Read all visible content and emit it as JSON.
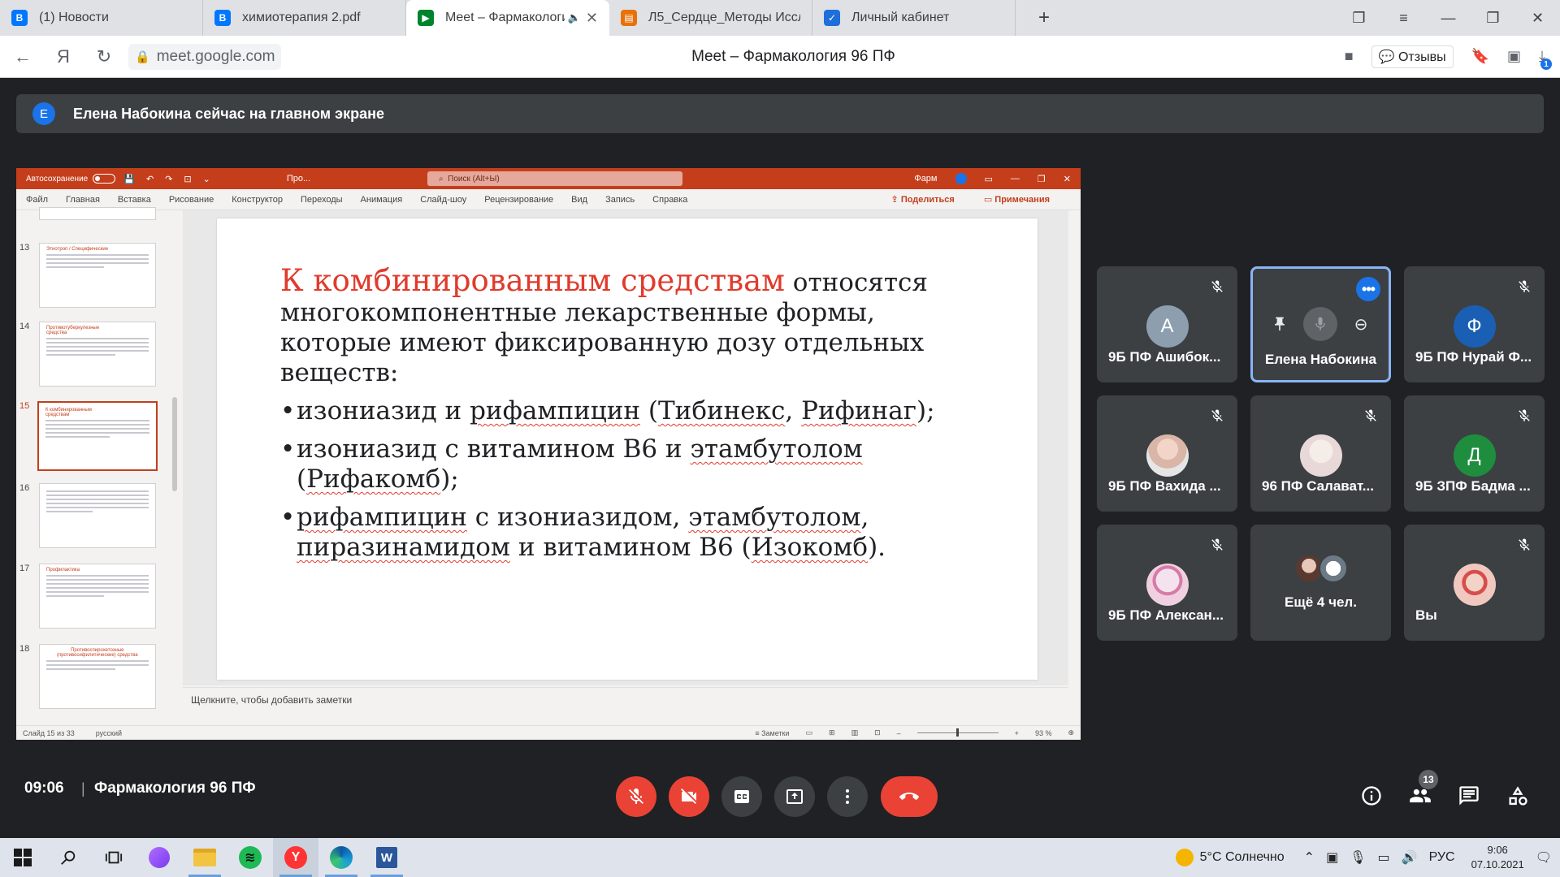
{
  "browser": {
    "tabs": [
      {
        "label": "(1) Новости",
        "icon": "vk-icon",
        "color": "#0077ff",
        "active": false
      },
      {
        "label": "химиотерапия 2.pdf",
        "icon": "vk-icon",
        "color": "#0077ff",
        "active": false
      },
      {
        "label": "Meet – Фармакологи",
        "icon": "meet-icon",
        "color": "#00832d",
        "active": true
      },
      {
        "label": "Л5_Сердце_Методы Иссле",
        "icon": "document-icon",
        "color": "#e8710a",
        "active": false
      },
      {
        "label": "Личный кабинет",
        "icon": "shield-icon",
        "color": "#1e6fd9",
        "active": false
      }
    ],
    "url": "meet.google.com",
    "page_title": "Meet – Фармакология 96 ПФ",
    "feedback_label": "Отзывы",
    "download_count": "1"
  },
  "banner": {
    "avatar_letter": "E",
    "text": "Елена Набокина сейчас на главном экране"
  },
  "powerpoint": {
    "autosave_label": "Автосохранение",
    "file_label": "Про...",
    "search_placeholder": "Поиск (Alt+Ы)",
    "user_label": "Фарм",
    "menu": [
      "Файл",
      "Главная",
      "Вставка",
      "Рисование",
      "Конструктор",
      "Переходы",
      "Анимация",
      "Слайд-шоу",
      "Рецензирование",
      "Вид",
      "Запись",
      "Справка"
    ],
    "share_label": "Поделиться",
    "comments_label": "Примечания",
    "thumbnails": [
      {
        "num": "13",
        "title": "Этиотроп / Специфические"
      },
      {
        "num": "14",
        "title": "Противотуберкулезные средства"
      },
      {
        "num": "15",
        "title": "К комбинированным средствам"
      },
      {
        "num": "16",
        "title": ""
      },
      {
        "num": "17",
        "title": "Профилактика"
      },
      {
        "num": "18",
        "title": "Противоспирохетозные (противосифилитические) средства"
      }
    ],
    "slide": {
      "lead_red": "К комбинированным средствам",
      "lead_rest": " относятся многокомпонентные лекарственные формы, которые имеют фиксированную дозу отдельных веществ:",
      "b1_a": "изониазид и ",
      "b1_sq1": "рифампицин",
      "b1_b": " (",
      "b1_sq2": "Тибинекс",
      "b1_c": ", ",
      "b1_sq3": "Рифинаг",
      "b1_d": ");",
      "b2_a": "изониазид с витамином В6 и ",
      "b2_sq1": "этамбутолом",
      "b2_b": " (",
      "b2_sq2": "Рифакомб",
      "b2_c": ");",
      "b3_sq1": "рифампицин",
      "b3_a": " с изониазидом, ",
      "b3_sq2": "этамбутолом",
      "b3_b": ", ",
      "b3_sq3": "пиразинамидом",
      "b3_c": " и витамином В6 (",
      "b3_sq4": "Изокомб",
      "b3_d": ")."
    },
    "notes_placeholder": "Щелкните, чтобы добавить заметки",
    "status_slide": "Слайд 15 из 33",
    "status_lang": "русский",
    "status_notes": "Заметки",
    "zoom": "93 %"
  },
  "participants": [
    {
      "name": "9Б ПФ Ашибок...",
      "letter": "А",
      "color": "#8d9eae",
      "muted": true
    },
    {
      "name": "Елена Набокина",
      "letter": "",
      "color": "",
      "muted": false,
      "active": true
    },
    {
      "name": "9Б ПФ Нурай Ф...",
      "letter": "Ф",
      "color": "#1a5fb4",
      "muted": true
    },
    {
      "name": "9Б ПФ Вахида ...",
      "letter": "",
      "color": "",
      "muted": true
    },
    {
      "name": "96 ПФ Салават...",
      "letter": "",
      "color": "",
      "muted": true
    },
    {
      "name": "9Б ЗПФ Бадма ...",
      "letter": "Д",
      "color": "#1e8e3e",
      "muted": true
    },
    {
      "name": "9Б ПФ Алексан...",
      "letter": "",
      "color": "",
      "muted": true
    },
    {
      "name": "Ещё 4 чел.",
      "letter": "",
      "color": "",
      "muted": false
    },
    {
      "name": "Вы",
      "letter": "",
      "color": "",
      "muted": true
    }
  ],
  "meet": {
    "time": "09:06",
    "separator": "|",
    "meeting_title": "Фармакология 96 ПФ",
    "people_count": "13"
  },
  "taskbar": {
    "weather": "5°C  Солнечно",
    "lang": "РУС",
    "time": "9:06",
    "date": "07.10.2021"
  }
}
